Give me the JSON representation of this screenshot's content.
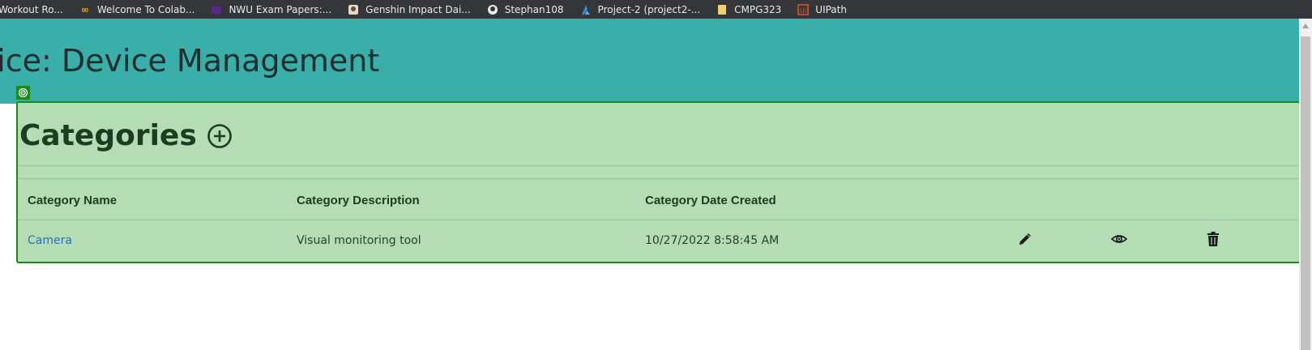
{
  "bookmarks": [
    {
      "label": "Workout Ro...",
      "icon": "bookmark-icon"
    },
    {
      "label": "Welcome To Colab...",
      "icon": "colab-icon"
    },
    {
      "label": "NWU Exam Papers:...",
      "icon": "nwu-icon"
    },
    {
      "label": "Genshin Impact Dai...",
      "icon": "genshin-icon"
    },
    {
      "label": "Stephan108",
      "icon": "github-icon"
    },
    {
      "label": "Project-2 (project2-...",
      "icon": "azure-icon"
    },
    {
      "label": "CMPG323",
      "icon": "folder-icon"
    },
    {
      "label": "UIPath",
      "icon": "uipath-icon"
    }
  ],
  "header": {
    "title": "ffice: Device Management"
  },
  "categories": {
    "heading": "Categories",
    "add_icon": "plus-circle-icon",
    "columns": [
      "Category Name",
      "Category Description",
      "Category Date Created"
    ],
    "rows": [
      {
        "name": "Camera",
        "description": "Visual monitoring tool",
        "date_created": "10/27/2022 8:58:45 AM"
      }
    ]
  },
  "colors": {
    "header_bg": "#3aafa9",
    "panel_bg": "#b4ddb5",
    "panel_border": "#1b8a1b",
    "link": "#2a6fb0"
  }
}
